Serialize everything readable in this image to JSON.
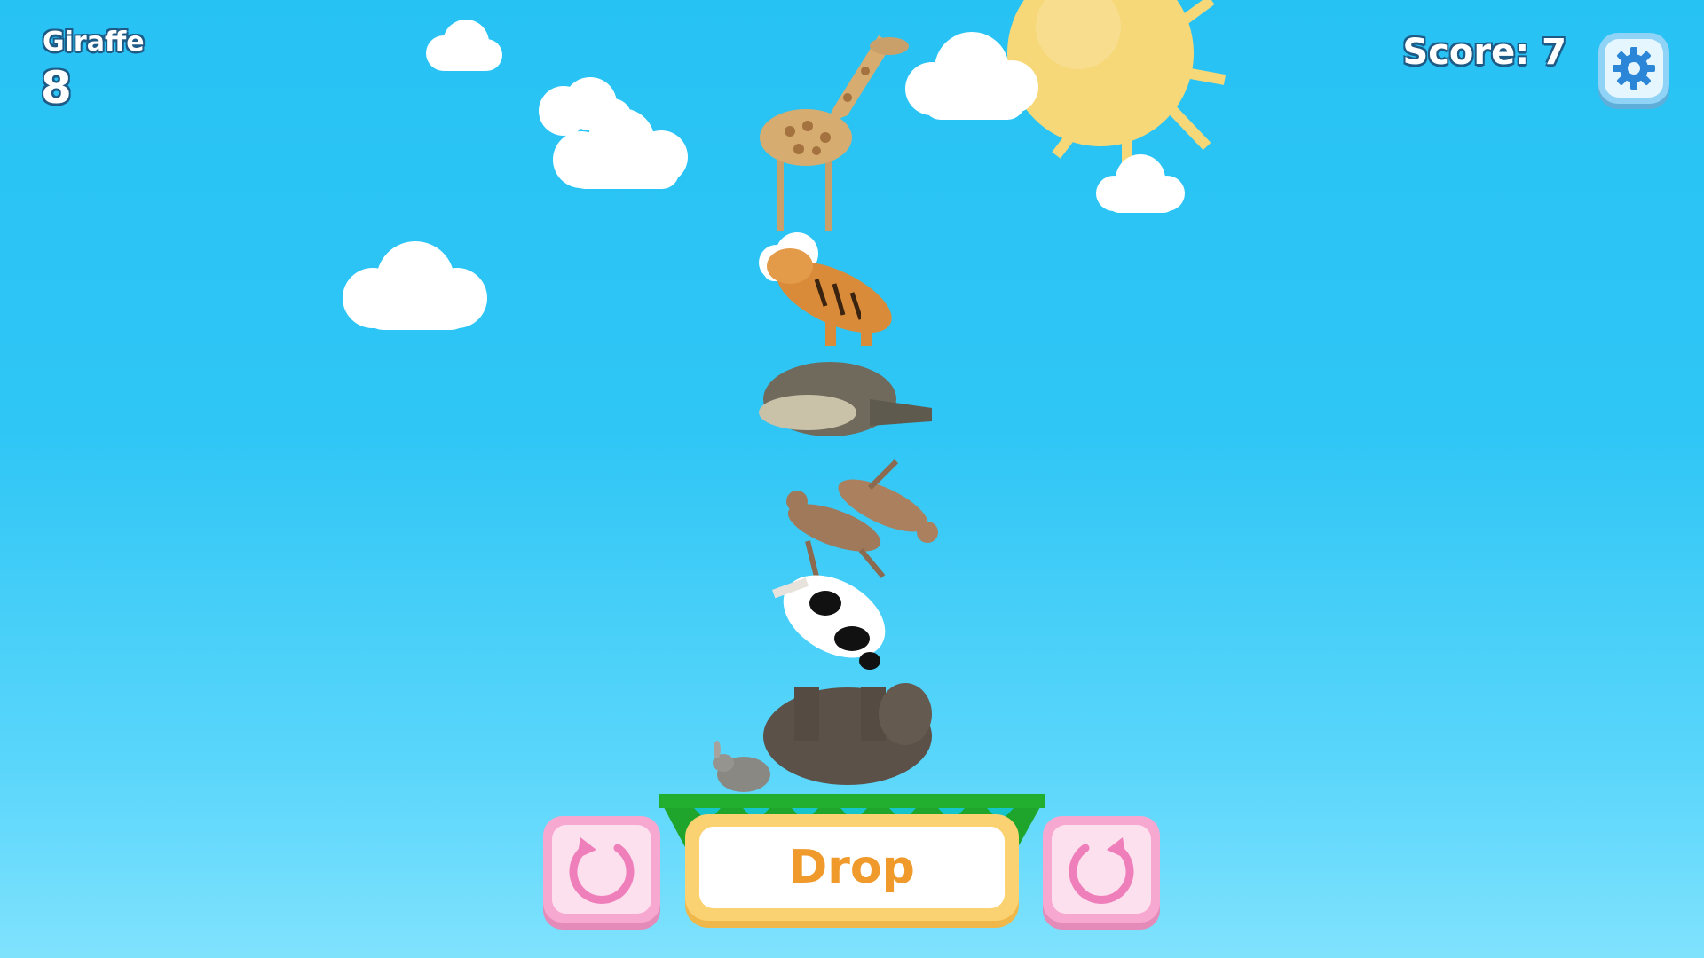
{
  "hud": {
    "animal_name": "Giraffe",
    "animal_count": "8",
    "score_label": "Score: 7"
  },
  "controls": {
    "drop_label": "Drop",
    "rotate_left_icon": "rotate-left-icon",
    "rotate_right_icon": "rotate-right-icon",
    "settings_icon": "gear-icon"
  },
  "tower": {
    "animals": [
      "giraffe",
      "tiger",
      "crocodile",
      "deer",
      "deer",
      "cow",
      "elephant",
      "rabbit"
    ]
  },
  "colors": {
    "sky_top": "#27c2f4",
    "sky_bottom": "#7fe2fd",
    "hud_outline": "#1e5a86",
    "button_pink": "#f7a8d0",
    "button_yellow": "#fbd272",
    "drop_text": "#f09a2b",
    "grass": "#1fa52b",
    "sun": "#f6d879"
  }
}
